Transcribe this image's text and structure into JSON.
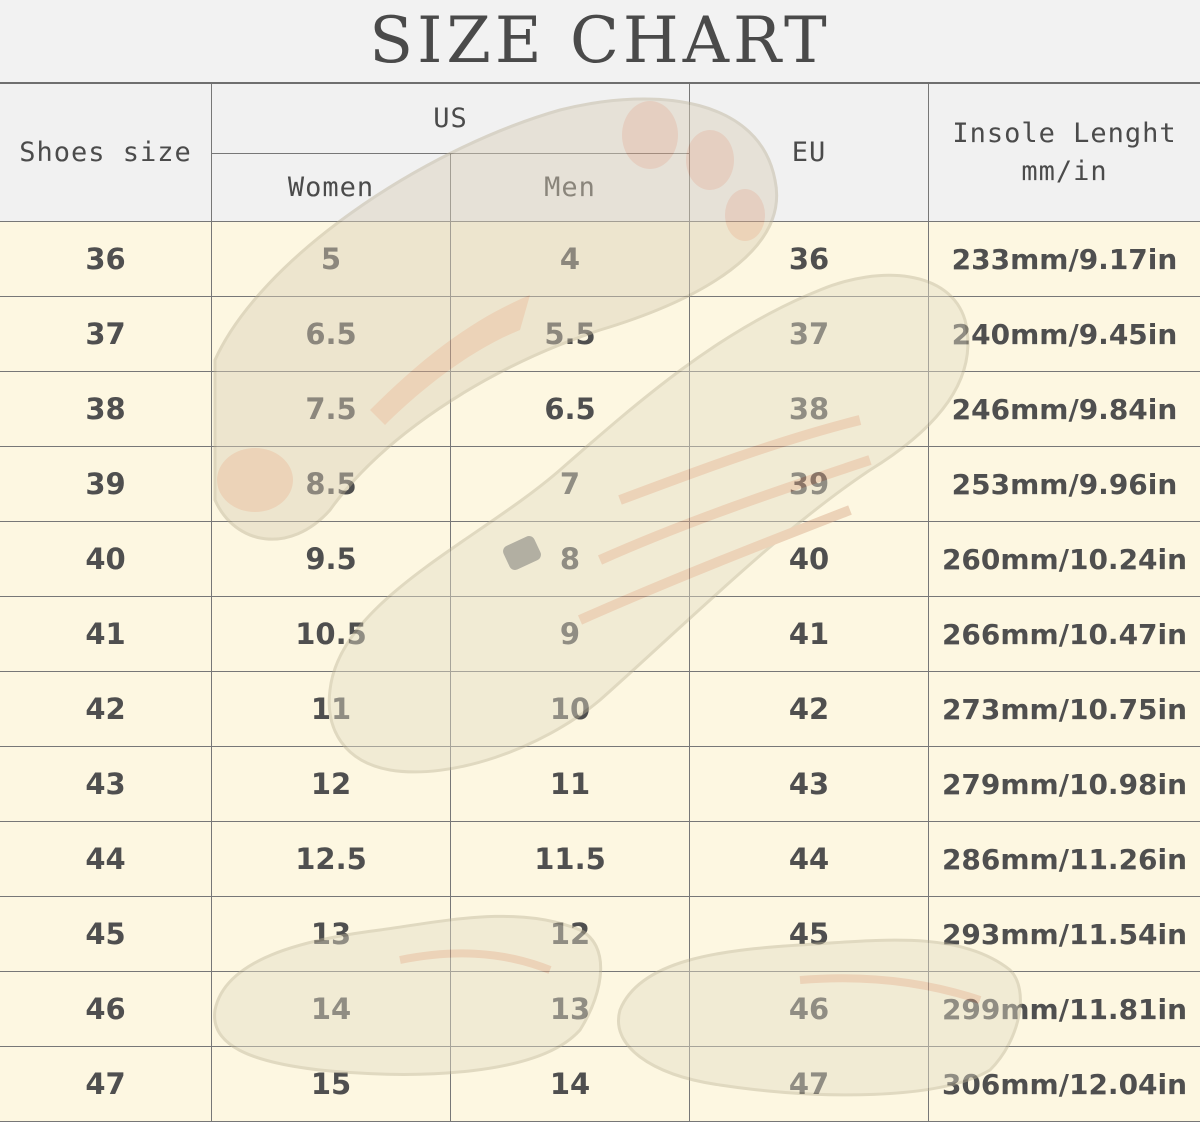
{
  "title": "SIZE CHART",
  "header": {
    "shoes_size": "Shoes size",
    "us": "US",
    "women": "Women",
    "men": "Men",
    "eu": "EU",
    "insole_line1": "Insole Lenght",
    "insole_line2": "mm/in"
  },
  "rows": [
    {
      "size": "36",
      "women": "5",
      "men": "4",
      "eu": "36",
      "insole": "233mm/9.17in"
    },
    {
      "size": "37",
      "women": "6.5",
      "men": "5.5",
      "eu": "37",
      "insole": "240mm/9.45in"
    },
    {
      "size": "38",
      "women": "7.5",
      "men": "6.5",
      "eu": "38",
      "insole": "246mm/9.84in"
    },
    {
      "size": "39",
      "women": "8.5",
      "men": "7",
      "eu": "39",
      "insole": "253mm/9.96in"
    },
    {
      "size": "40",
      "women": "9.5",
      "men": "8",
      "eu": "40",
      "insole": "260mm/10.24in"
    },
    {
      "size": "41",
      "women": "10.5",
      "men": "9",
      "eu": "41",
      "insole": "266mm/10.47in"
    },
    {
      "size": "42",
      "women": "11",
      "men": "10",
      "eu": "42",
      "insole": "273mm/10.75in"
    },
    {
      "size": "43",
      "women": "12",
      "men": "11",
      "eu": "43",
      "insole": "279mm/10.98in"
    },
    {
      "size": "44",
      "women": "12.5",
      "men": "11.5",
      "eu": "44",
      "insole": "286mm/11.26in"
    },
    {
      "size": "45",
      "women": "13",
      "men": "12",
      "eu": "45",
      "insole": "293mm/11.54in"
    },
    {
      "size": "46",
      "women": "14",
      "men": "13",
      "eu": "46",
      "insole": "299mm/11.81in"
    },
    {
      "size": "47",
      "women": "15",
      "men": "14",
      "eu": "47",
      "insole": "306mm/12.04in"
    }
  ],
  "colors": {
    "header_bg": "#f1f1f1",
    "body_bg": "#fdf7e1",
    "grid_line": "#777777",
    "text": "#4f4f4f",
    "shoe_beige": "#dcd4bf",
    "shoe_accent": "#d7a587"
  }
}
